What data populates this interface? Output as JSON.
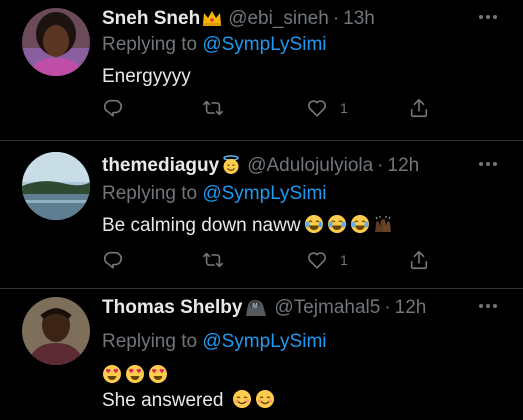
{
  "colors": {
    "background": "#000000",
    "text": "#e7e9ea",
    "muted": "#71767b",
    "link": "#1d9bf0",
    "divider": "#2f3336"
  },
  "tweets": [
    {
      "name": "Sneh Sneh",
      "badge_icon": "crown-emoji",
      "handle": "@ebi_sineh",
      "dot": "·",
      "time": "13h",
      "replying_prefix": "Replying to",
      "replying_to": "@SympLySimi",
      "text": "Energyyyy",
      "like_count": "1",
      "icons": [
        "reply-icon",
        "retweet-icon",
        "like-icon",
        "share-icon"
      ]
    },
    {
      "name": "themediaguy",
      "badge_icon": "smiling-face-with-halo-emoji",
      "handle": "@Adulojulyiola",
      "dot": "·",
      "time": "12h",
      "replying_prefix": "Replying to",
      "replying_to": "@SympLySimi",
      "text": "Be calming down naww",
      "emojis": [
        "face-with-tears-of-joy",
        "face-with-tears-of-joy",
        "face-with-tears-of-joy",
        "raising-hands"
      ],
      "like_count": "1",
      "icons": [
        "reply-icon",
        "retweet-icon",
        "like-icon",
        "share-icon"
      ]
    },
    {
      "name": "Thomas Shelby",
      "badge_icon": "gorilla-emoji",
      "handle": "@Tejmahal5",
      "dot": "·",
      "time": "12h",
      "replying_prefix": "Replying to",
      "replying_to": "@SympLySimi",
      "line1_emojis": [
        "smiling-face-with-heart-eyes",
        "smiling-face-with-heart-eyes",
        "smiling-face-with-heart-eyes"
      ],
      "text": "She answered",
      "line2_emojis": [
        "smiling-face-with-smiling-eyes",
        "smiling-face-with-smiling-eyes"
      ]
    }
  ]
}
